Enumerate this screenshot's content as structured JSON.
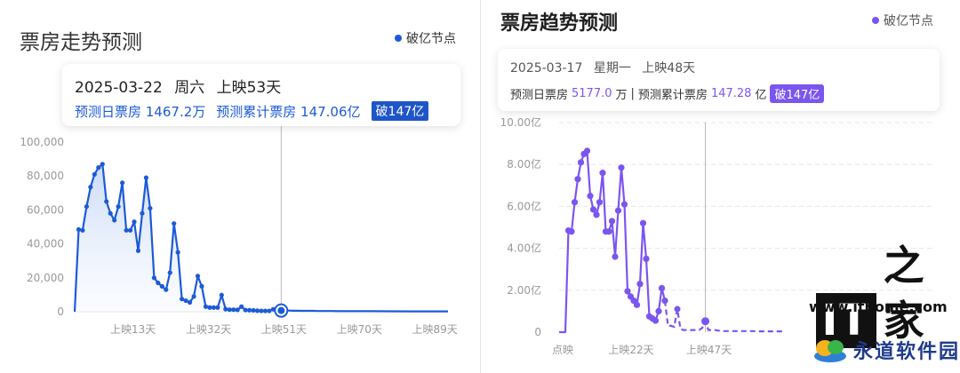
{
  "left": {
    "title": "票房走势预测",
    "legend": "破亿节点",
    "tooltip": {
      "date": "2025-03-22",
      "weekday": "周六",
      "day": "上映53天",
      "daily_label": "预测日票房 1467.2万",
      "total_label": "预测累计票房 147.06亿",
      "badge": "破147亿"
    },
    "colors": {
      "line": "#1c5ad8",
      "fill_top": "#c9d9f7",
      "fill_bottom": "#f3f7fe"
    }
  },
  "right": {
    "title": "票房趋势预测",
    "legend": "破亿节点",
    "tooltip": {
      "date": "2025-03-17",
      "weekday": "星期一",
      "day": "上映48天",
      "daily_prefix": "预测日票房",
      "daily_value": "5177.0",
      "daily_unit": "万",
      "separator": "|",
      "total_prefix": "预测累计票房",
      "total_value": "147.28",
      "total_unit": "亿",
      "badge": "破147亿"
    },
    "colors": {
      "line": "#7b55f0"
    }
  },
  "watermark": {
    "logo": "IT",
    "logo_char": "之家",
    "url": "www.ithome.com",
    "brand": "永道软件园"
  },
  "chart_data": [
    {
      "type": "line",
      "y_tick_labels": [
        "0",
        "20,000",
        "40,000",
        "60,000",
        "80,000",
        "100,000"
      ],
      "ylim": [
        0,
        100000
      ],
      "x_tick_labels": [
        "上映13天",
        "上映32天",
        "上映51天",
        "上映70天",
        "上映89天"
      ],
      "x_ticks": [
        13,
        32,
        51,
        70,
        89
      ],
      "xlim": [
        1,
        95
      ],
      "highlight_x": 53,
      "series": [
        {
          "x": [
            1,
            2,
            3,
            4,
            5,
            6,
            7,
            8,
            9,
            10,
            11,
            12,
            13,
            14,
            15,
            16,
            17,
            18,
            19,
            20,
            21,
            22,
            23,
            24,
            25,
            26,
            27,
            28,
            29,
            30,
            31,
            32,
            33,
            34,
            35,
            36,
            37,
            38,
            39,
            40,
            41,
            42,
            43,
            44,
            45,
            46,
            47,
            48,
            49,
            50,
            51,
            52,
            53,
            54,
            55,
            56,
            57,
            58,
            59,
            60,
            61,
            62,
            63,
            64,
            65,
            66,
            67,
            68,
            69,
            70,
            75,
            80,
            85,
            90,
            95
          ],
          "y": [
            0,
            48500,
            48000,
            62000,
            73500,
            81000,
            85000,
            87000,
            65000,
            58000,
            54000,
            62000,
            76000,
            48000,
            48000,
            53000,
            36000,
            58000,
            79000,
            61000,
            20000,
            17000,
            15000,
            13000,
            23000,
            52000,
            35000,
            7500,
            6500,
            5500,
            9000,
            21000,
            15000,
            3000,
            2500,
            2500,
            2500,
            9800,
            1500,
            1200,
            1200,
            1100,
            3000,
            1000,
            900,
            800,
            600,
            500,
            500,
            500,
            1467,
            700,
            700,
            700,
            700,
            600,
            600,
            500,
            500,
            500,
            500,
            400,
            400,
            400,
            400,
            400,
            300,
            300,
            300,
            300,
            300,
            250,
            200,
            200,
            200
          ]
        }
      ]
    },
    {
      "type": "line",
      "y_tick_labels": [
        "0",
        "2.00亿",
        "4.00亿",
        "6.00亿",
        "8.00亿",
        "10.00亿"
      ],
      "ylim": [
        0,
        10
      ],
      "x_tick_labels": [
        "点映",
        "上映22天",
        "上映47天"
      ],
      "x_ticks": [
        0,
        22,
        47
      ],
      "xlim": [
        0,
        72
      ],
      "highlight_x": 47,
      "series": [
        {
          "name": "actual",
          "x": [
            0,
            2,
            3,
            4,
            5,
            6,
            7,
            8,
            9,
            10,
            11,
            12,
            13,
            14,
            15,
            16,
            17,
            18,
            19,
            20,
            21,
            22,
            23,
            24,
            25,
            26,
            27,
            28,
            29,
            30,
            31,
            32,
            33,
            34
          ],
          "y": [
            0,
            0,
            4.85,
            4.8,
            6.2,
            7.3,
            8.1,
            8.5,
            8.65,
            6.5,
            5.85,
            5.6,
            6.2,
            7.6,
            4.8,
            4.8,
            5.3,
            3.6,
            5.8,
            7.85,
            6.1,
            1.95,
            1.7,
            1.5,
            1.3,
            2.3,
            5.2,
            3.5,
            0.75,
            0.65,
            0.55,
            1.0,
            2.1,
            1.5
          ]
        },
        {
          "name": "forecast",
          "x": [
            34,
            35,
            36,
            37,
            38,
            39,
            40,
            41,
            42,
            43,
            44,
            45,
            46,
            47,
            48,
            49,
            50,
            52,
            54,
            56,
            58,
            60,
            62,
            64,
            66,
            68,
            70,
            72
          ],
          "y": [
            1.5,
            0.3,
            0.3,
            0.25,
            1.1,
            0.15,
            0.1,
            0.1,
            0.1,
            0.1,
            0.1,
            0.1,
            0.2,
            0.52,
            0.1,
            0.1,
            0.1,
            0.05,
            0.05,
            0.05,
            0.05,
            0.05,
            0.05,
            0.04,
            0.04,
            0.04,
            0.04,
            0.04
          ]
        }
      ]
    }
  ]
}
